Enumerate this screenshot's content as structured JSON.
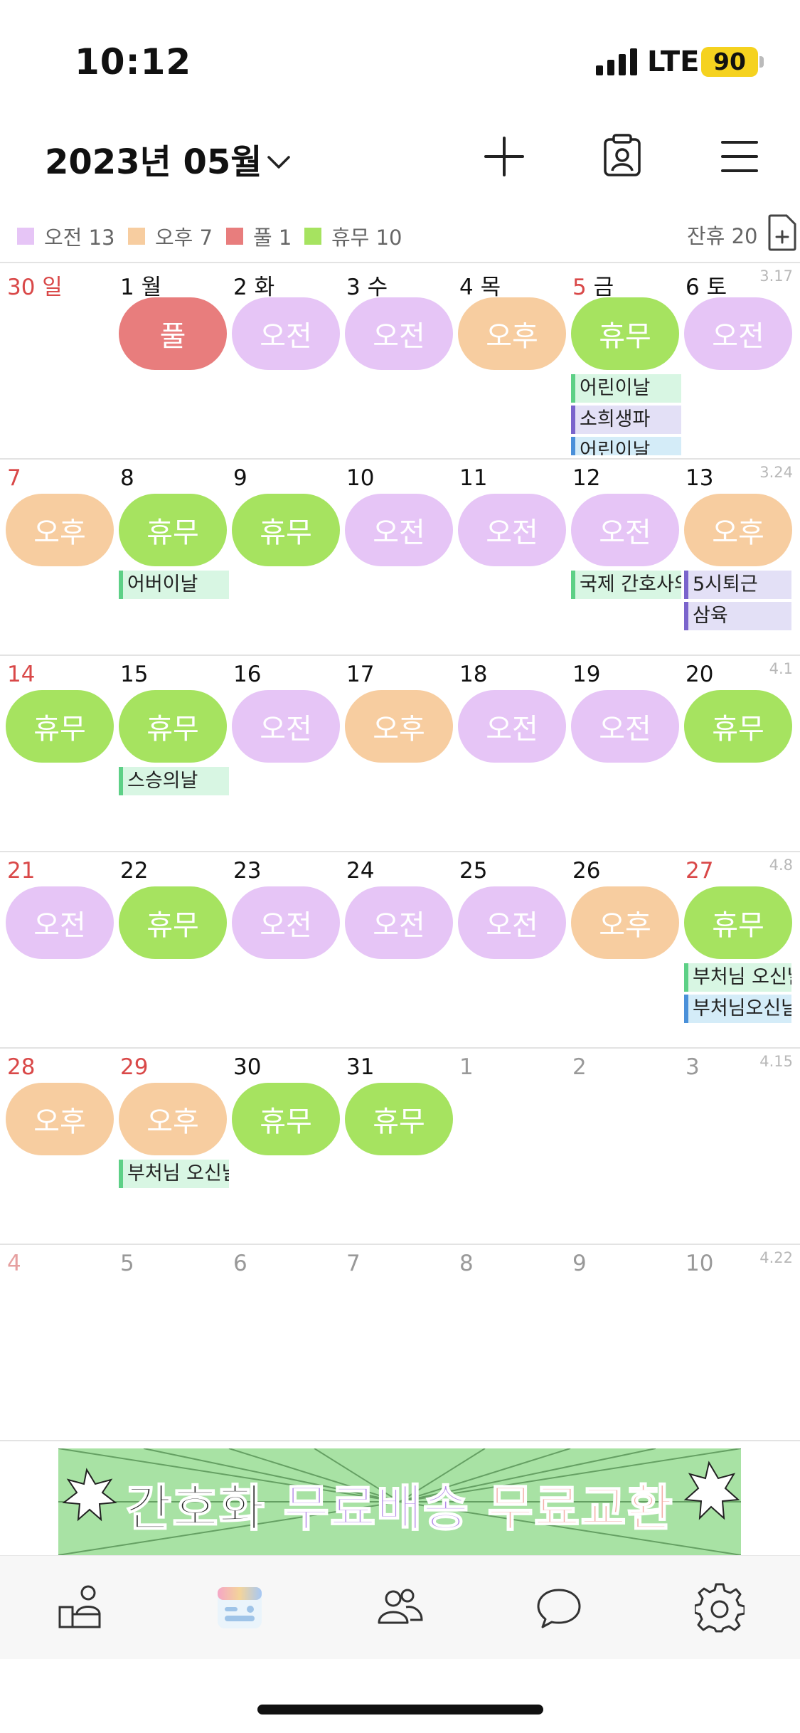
{
  "status_bar": {
    "time": "10:12",
    "network": "LTE",
    "battery": "90"
  },
  "header": {
    "month_title": "2023년 05월"
  },
  "icons": {
    "chevron": "chevron-down-icon",
    "add": "plus-icon",
    "profile": "id-badge-icon",
    "menu": "hamburger-menu-icon",
    "add_doc": "document-plus-icon"
  },
  "legend": [
    {
      "label": "오전 13",
      "color": "#e6c5f6"
    },
    {
      "label": "오후 7",
      "color": "#f7cda0"
    },
    {
      "label": "풀 1",
      "color": "#e87d7d"
    },
    {
      "label": "휴무 10",
      "color": "#a6e360"
    }
  ],
  "remaining_leave": "잔휴 20",
  "shift_colors": {
    "오전": "#e6c5f6",
    "오후": "#f7cda0",
    "풀": "#e87d7d",
    "휴무": "#a6e360"
  },
  "weeks": [
    {
      "week_label": "3.17",
      "days": [
        {
          "label": "30 일",
          "shift": "",
          "style": "red"
        },
        {
          "label": "1 월",
          "shift": "풀"
        },
        {
          "label": "2 화",
          "shift": "오전"
        },
        {
          "label": "3 수",
          "shift": "오전"
        },
        {
          "label": "4 목",
          "shift": "오후"
        },
        {
          "label": "5 금",
          "shift": "휴무",
          "red_num": true,
          "events": [
            {
              "text": "어린이날",
              "bg": "#d8f6e3",
              "bar": "#5dd086"
            },
            {
              "text": "소희생파",
              "bg": "#e3e0f6",
              "bar": "#7a64cc"
            },
            {
              "text": "어린이날",
              "bg": "#d4ecf8",
              "bar": "#4a90d9"
            }
          ]
        },
        {
          "label": "6 토",
          "shift": "오전"
        }
      ]
    },
    {
      "week_label": "3.24",
      "days": [
        {
          "label": "7",
          "shift": "오후",
          "style": "red"
        },
        {
          "label": "8",
          "shift": "휴무",
          "events": [
            {
              "text": "어버이날",
              "bg": "#d8f6e3",
              "bar": "#5dd086"
            }
          ]
        },
        {
          "label": "9",
          "shift": "휴무"
        },
        {
          "label": "10",
          "shift": "오전"
        },
        {
          "label": "11",
          "shift": "오전"
        },
        {
          "label": "12",
          "shift": "오전",
          "events": [
            {
              "text": "국제 간호사의날",
              "bg": "#d8f6e3",
              "bar": "#5dd086"
            }
          ]
        },
        {
          "label": "13",
          "shift": "오후",
          "events": [
            {
              "text": "5시퇴근",
              "bg": "#e3e0f6",
              "bar": "#7a64cc"
            },
            {
              "text": "삼육",
              "bg": "#e3e0f6",
              "bar": "#7a64cc"
            }
          ]
        }
      ]
    },
    {
      "week_label": "4.1",
      "days": [
        {
          "label": "14",
          "shift": "휴무",
          "style": "red"
        },
        {
          "label": "15",
          "shift": "휴무",
          "events": [
            {
              "text": "스승의날",
              "bg": "#d8f6e3",
              "bar": "#5dd086"
            }
          ]
        },
        {
          "label": "16",
          "shift": "오전"
        },
        {
          "label": "17",
          "shift": "오후"
        },
        {
          "label": "18",
          "shift": "오전"
        },
        {
          "label": "19",
          "shift": "오전"
        },
        {
          "label": "20",
          "shift": "휴무"
        }
      ]
    },
    {
      "week_label": "4.8",
      "days": [
        {
          "label": "21",
          "shift": "오전",
          "style": "red"
        },
        {
          "label": "22",
          "shift": "휴무"
        },
        {
          "label": "23",
          "shift": "오전"
        },
        {
          "label": "24",
          "shift": "오전"
        },
        {
          "label": "25",
          "shift": "오전"
        },
        {
          "label": "26",
          "shift": "오후"
        },
        {
          "label": "27",
          "shift": "휴무",
          "style": "red",
          "events": [
            {
              "text": "부처님 오신날",
              "bg": "#d8f6e3",
              "bar": "#5dd086"
            },
            {
              "text": "부처님오신날",
              "bg": "#d4ecf8",
              "bar": "#4a90d9"
            }
          ]
        }
      ]
    },
    {
      "week_label": "4.15",
      "days": [
        {
          "label": "28",
          "shift": "오후",
          "style": "red"
        },
        {
          "label": "29",
          "shift": "오후",
          "style": "red",
          "events": [
            {
              "text": "부처님 오신날",
              "bg": "#d8f6e3",
              "bar": "#5dd086"
            }
          ]
        },
        {
          "label": "30",
          "shift": "휴무"
        },
        {
          "label": "31",
          "shift": "휴무"
        },
        {
          "label": "1",
          "shift": "",
          "style": "dim"
        },
        {
          "label": "2",
          "shift": "",
          "style": "dim"
        },
        {
          "label": "3",
          "shift": "",
          "style": "dim"
        }
      ]
    },
    {
      "week_label": "4.22",
      "days": [
        {
          "label": "4",
          "shift": "",
          "style": "dim-red"
        },
        {
          "label": "5",
          "shift": "",
          "style": "dim"
        },
        {
          "label": "6",
          "shift": "",
          "style": "dim"
        },
        {
          "label": "7",
          "shift": "",
          "style": "dim"
        },
        {
          "label": "8",
          "shift": "",
          "style": "dim"
        },
        {
          "label": "9",
          "shift": "",
          "style": "dim"
        },
        {
          "label": "10",
          "shift": "",
          "style": "dim"
        }
      ]
    }
  ],
  "banner": {
    "part1": "간호화 ",
    "part2": "무료배송 ",
    "part3": "무료교환"
  },
  "tabs": [
    {
      "name": "tab-my",
      "icon": "person-desk-icon"
    },
    {
      "name": "tab-calendar",
      "icon": "calendar-icon",
      "active": true
    },
    {
      "name": "tab-group",
      "icon": "people-icon"
    },
    {
      "name": "tab-chat",
      "icon": "chat-bubble-icon"
    },
    {
      "name": "tab-settings",
      "icon": "gear-icon"
    }
  ]
}
